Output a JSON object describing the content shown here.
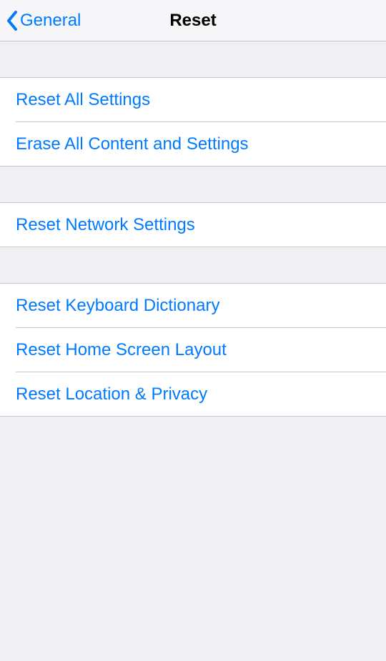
{
  "nav": {
    "back_label": "General",
    "title": "Reset"
  },
  "groups": [
    {
      "rows": [
        {
          "label": "Reset All Settings"
        },
        {
          "label": "Erase All Content and Settings"
        }
      ]
    },
    {
      "rows": [
        {
          "label": "Reset Network Settings"
        }
      ]
    },
    {
      "rows": [
        {
          "label": "Reset Keyboard Dictionary"
        },
        {
          "label": "Reset Home Screen Layout"
        },
        {
          "label": "Reset Location & Privacy"
        }
      ]
    }
  ],
  "colors": {
    "link": "#007aff",
    "bg": "#efeff4",
    "separator": "#c8c7cc"
  }
}
